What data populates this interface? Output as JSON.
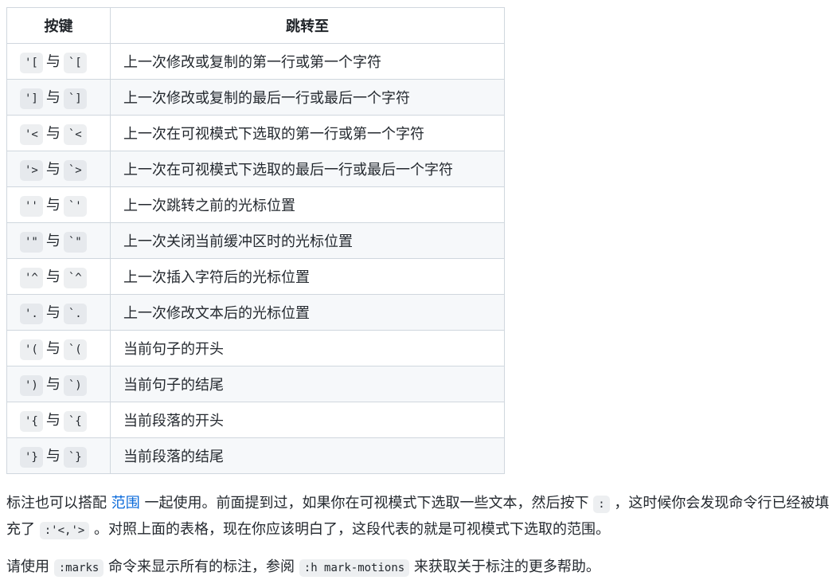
{
  "table": {
    "headers": [
      "按键",
      "跳转至"
    ],
    "connector": "与",
    "rows": [
      {
        "k1": "'[",
        "k2": "`[",
        "desc": "上一次修改或复制的第一行或第一个字符"
      },
      {
        "k1": "']",
        "k2": "`]",
        "desc": "上一次修改或复制的最后一行或最后一个字符"
      },
      {
        "k1": "'<",
        "k2": "`<",
        "desc": "上一次在可视模式下选取的第一行或第一个字符"
      },
      {
        "k1": "'>",
        "k2": "`>",
        "desc": "上一次在可视模式下选取的最后一行或最后一个字符"
      },
      {
        "k1": "''",
        "k2": "`'",
        "desc": "上一次跳转之前的光标位置"
      },
      {
        "k1": "'\"",
        "k2": "`\"",
        "desc": "上一次关闭当前缓冲区时的光标位置"
      },
      {
        "k1": "'^",
        "k2": "`^",
        "desc": "上一次插入字符后的光标位置"
      },
      {
        "k1": "'.",
        "k2": "`.",
        "desc": "上一次修改文本后的光标位置"
      },
      {
        "k1": "'(",
        "k2": "`(",
        "desc": "当前句子的开头"
      },
      {
        "k1": "')",
        "k2": "`)",
        "desc": "当前句子的结尾"
      },
      {
        "k1": "'{",
        "k2": "`{",
        "desc": "当前段落的开头"
      },
      {
        "k1": "'}",
        "k2": "`}",
        "desc": "当前段落的结尾"
      }
    ]
  },
  "para1": {
    "before_link": "标注也可以搭配 ",
    "link": "范围",
    "after_link": " 一起使用。前面提到过，如果你在可视模式下选取一些文本，然后按下 ",
    "code1": ":",
    "mid": " ，这时候你会发现命令行已经被填充了 ",
    "code2": ":'<,'>",
    "end": " 。对照上面的表格，现在你应该明白了，这段代表的就是可视模式下选取的范围。"
  },
  "para2": {
    "before": "请使用 ",
    "code1": ":marks",
    "mid": " 命令来显示所有的标注，参阅 ",
    "code2": ":h mark-motions",
    "end": " 来获取关于标注的更多帮助。"
  },
  "colors": {
    "link": "#0969da",
    "border": "#d0d7de",
    "stripe": "#f6f8fa",
    "code_bg": "rgba(175,184,193,0.22)"
  }
}
